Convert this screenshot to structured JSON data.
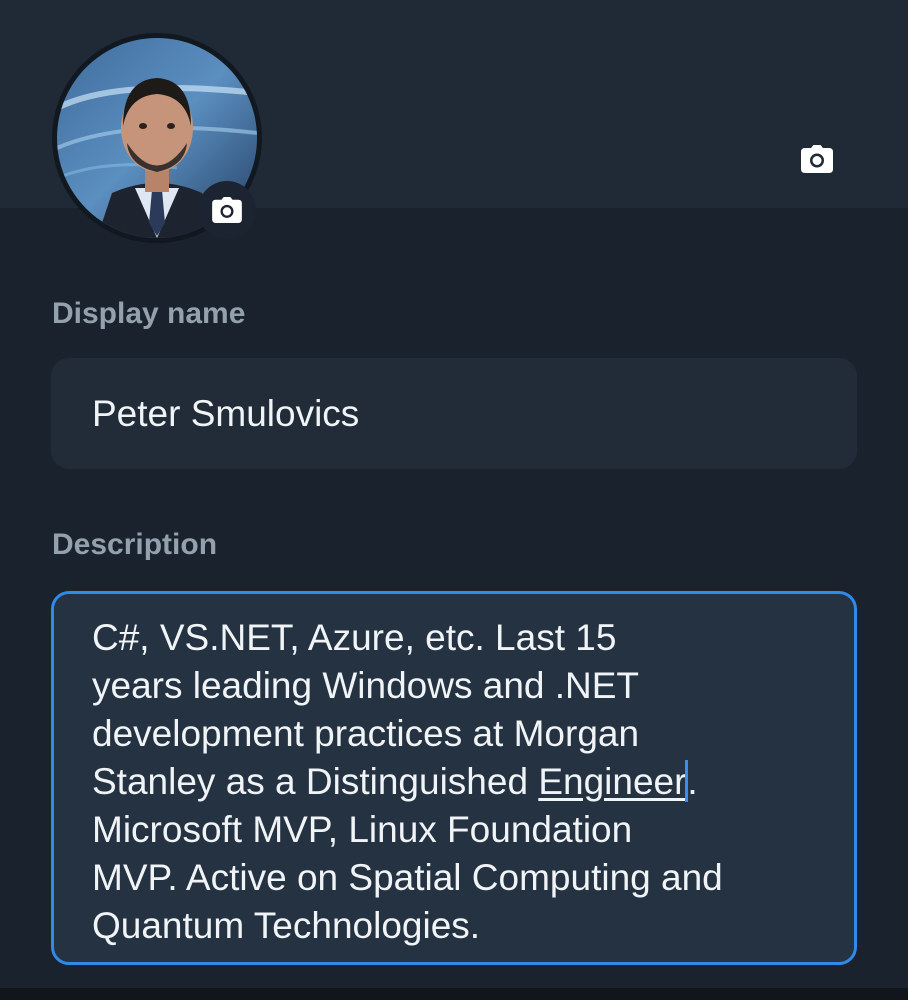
{
  "profile": {
    "avatar": {
      "icon": "camera-icon",
      "description_icon": "person-photo"
    },
    "banner": {
      "icon": "camera-icon"
    }
  },
  "form": {
    "display_name": {
      "label": "Display name",
      "value": "Peter Smulovics"
    },
    "description": {
      "label": "Description",
      "text_before": "C#, VS.NET, Azure, etc. Last 15\nyears leading Windows and .NET\ndevelopment practices at Morgan\nStanley as a Distinguished ",
      "underlined_word": "Engineer",
      "text_after": ".\nMicrosoft MVP, Linux Foundation\nMVP. Active on Spatial Computing and\nQuantum Technologies."
    }
  },
  "colors": {
    "accent": "#2f8ae8",
    "label": "#93a0ad",
    "field_bg": "#222c38",
    "page_bg": "#1a222d"
  }
}
